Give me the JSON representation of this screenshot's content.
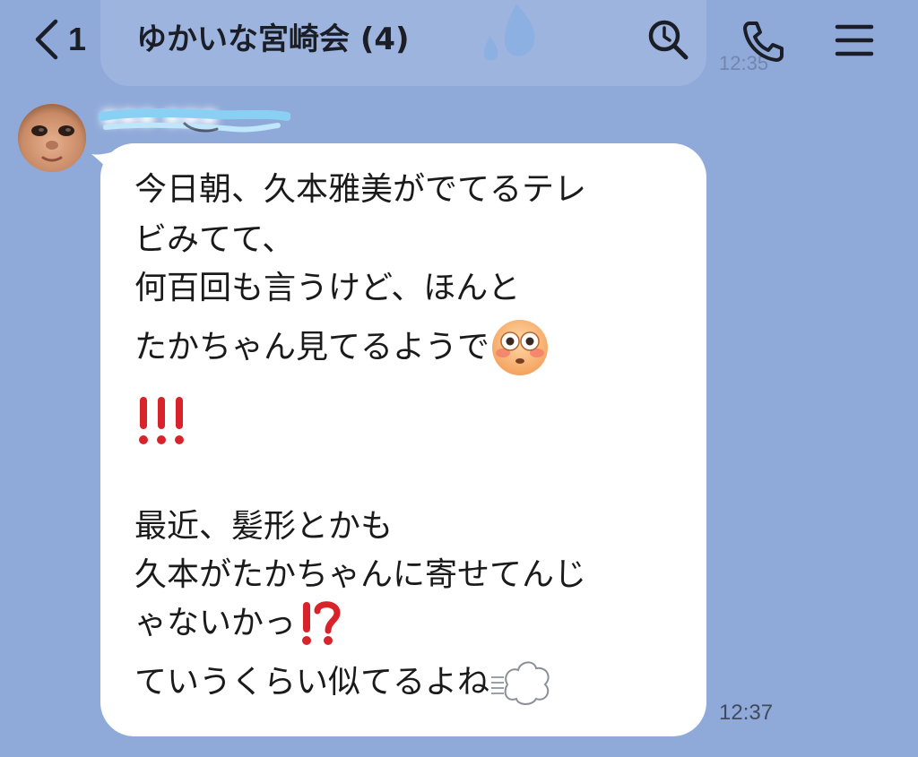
{
  "header": {
    "back_count": "1",
    "title": "ゆかいな宮崎会 (4)"
  },
  "faded_previous": {
    "time": "12:35"
  },
  "message": {
    "sender_name": "■■■ ■■■",
    "lines": [
      "今日朝、久本雅美がでてるテレ",
      "ビみてて、",
      "何百回も言うけど、ほんと",
      "たかちゃん見てるようで",
      "",
      "最近、髪形とかも",
      "久本がたかちゃんに寄せてんじ",
      "ゃないかっ",
      "ていうくらい似てるよね"
    ],
    "time": "12:37"
  },
  "icons": {
    "back": "chevron-left-icon",
    "search": "search-icon",
    "call": "phone-icon",
    "menu": "hamburger-menu-icon",
    "emoji_flushed": "flushed-face-emoji",
    "emoji_exclamation": "triple-exclamation-emoji",
    "emoji_interrobang": "interrobang-emoji",
    "emoji_dash": "dashing-away-emoji"
  },
  "colors": {
    "background": "#8fa9d9",
    "bubble": "#ffffff",
    "text": "#1b1e26",
    "accent_red": "#d9232b"
  }
}
